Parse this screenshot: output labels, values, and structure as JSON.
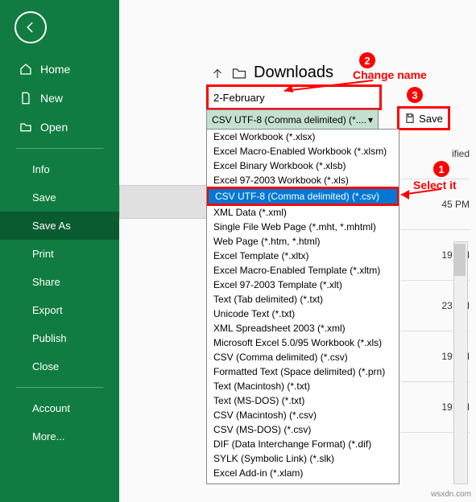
{
  "sidebar": {
    "items": [
      {
        "label": "Home",
        "icon": "home-icon"
      },
      {
        "label": "New",
        "icon": "new-icon"
      },
      {
        "label": "Open",
        "icon": "open-icon"
      }
    ],
    "sub_items": [
      {
        "label": "Info"
      },
      {
        "label": "Save"
      },
      {
        "label": "Save As",
        "active": true
      },
      {
        "label": "Print"
      },
      {
        "label": "Share"
      },
      {
        "label": "Export"
      },
      {
        "label": "Publish"
      },
      {
        "label": "Close"
      }
    ],
    "bottom_items": [
      {
        "label": "Account"
      },
      {
        "label": "More..."
      }
    ]
  },
  "location": {
    "folder": "Downloads",
    "filename": "2-February"
  },
  "save_button": "Save",
  "dropdown": {
    "selected": "CSV UTF-8 (Comma delimited) (*....",
    "options": [
      "Excel Workbook (*.xlsx)",
      "Excel Macro-Enabled Workbook (*.xlsm)",
      "Excel Binary Workbook (*.xlsb)",
      "Excel 97-2003 Workbook (*.xls)",
      "CSV UTF-8 (Comma delimited) (*.csv)",
      "XML Data (*.xml)",
      "Single File Web Page (*.mht, *.mhtml)",
      "Web Page (*.htm, *.html)",
      "Excel Template (*.xltx)",
      "Excel Macro-Enabled Template (*.xltm)",
      "Excel 97-2003 Template (*.xlt)",
      "Text (Tab delimited) (*.txt)",
      "Unicode Text (*.txt)",
      "XML Spreadsheet 2003 (*.xml)",
      "Microsoft Excel 5.0/95 Workbook (*.xls)",
      "CSV (Comma delimited) (*.csv)",
      "Formatted Text (Space delimited) (*.prn)",
      "Text (Macintosh) (*.txt)",
      "Text (MS-DOS) (*.txt)",
      "CSV (Macintosh) (*.csv)",
      "CSV (MS-DOS) (*.csv)",
      "DIF (Data Interchange Format) (*.dif)",
      "SYLK (Symbolic Link) (*.slk)",
      "Excel Add-in (*.xlam)"
    ],
    "highlighted_index": 4
  },
  "annotations": {
    "a1": "1",
    "a1_label": "Select it",
    "a2": "2",
    "a2_label": "Change name",
    "a3": "3"
  },
  "right_panel": {
    "times": [
      "ified",
      "45 PM",
      "19 PM",
      "23 PM",
      "19 PM",
      "19 PM"
    ]
  },
  "watermark": "wsxdn.com"
}
